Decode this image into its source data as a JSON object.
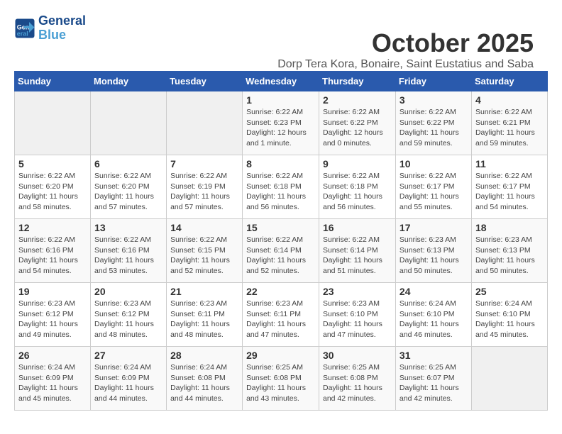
{
  "logo": {
    "line1": "General",
    "line2": "Blue"
  },
  "title": "October 2025",
  "subtitle": "Dorp Tera Kora, Bonaire, Saint Eustatius and Saba",
  "weekdays": [
    "Sunday",
    "Monday",
    "Tuesday",
    "Wednesday",
    "Thursday",
    "Friday",
    "Saturday"
  ],
  "weeks": [
    [
      {
        "day": "",
        "info": ""
      },
      {
        "day": "",
        "info": ""
      },
      {
        "day": "",
        "info": ""
      },
      {
        "day": "1",
        "info": "Sunrise: 6:22 AM\nSunset: 6:23 PM\nDaylight: 12 hours\nand 1 minute."
      },
      {
        "day": "2",
        "info": "Sunrise: 6:22 AM\nSunset: 6:22 PM\nDaylight: 12 hours\nand 0 minutes."
      },
      {
        "day": "3",
        "info": "Sunrise: 6:22 AM\nSunset: 6:22 PM\nDaylight: 11 hours\nand 59 minutes."
      },
      {
        "day": "4",
        "info": "Sunrise: 6:22 AM\nSunset: 6:21 PM\nDaylight: 11 hours\nand 59 minutes."
      }
    ],
    [
      {
        "day": "5",
        "info": "Sunrise: 6:22 AM\nSunset: 6:20 PM\nDaylight: 11 hours\nand 58 minutes."
      },
      {
        "day": "6",
        "info": "Sunrise: 6:22 AM\nSunset: 6:20 PM\nDaylight: 11 hours\nand 57 minutes."
      },
      {
        "day": "7",
        "info": "Sunrise: 6:22 AM\nSunset: 6:19 PM\nDaylight: 11 hours\nand 57 minutes."
      },
      {
        "day": "8",
        "info": "Sunrise: 6:22 AM\nSunset: 6:18 PM\nDaylight: 11 hours\nand 56 minutes."
      },
      {
        "day": "9",
        "info": "Sunrise: 6:22 AM\nSunset: 6:18 PM\nDaylight: 11 hours\nand 56 minutes."
      },
      {
        "day": "10",
        "info": "Sunrise: 6:22 AM\nSunset: 6:17 PM\nDaylight: 11 hours\nand 55 minutes."
      },
      {
        "day": "11",
        "info": "Sunrise: 6:22 AM\nSunset: 6:17 PM\nDaylight: 11 hours\nand 54 minutes."
      }
    ],
    [
      {
        "day": "12",
        "info": "Sunrise: 6:22 AM\nSunset: 6:16 PM\nDaylight: 11 hours\nand 54 minutes."
      },
      {
        "day": "13",
        "info": "Sunrise: 6:22 AM\nSunset: 6:16 PM\nDaylight: 11 hours\nand 53 minutes."
      },
      {
        "day": "14",
        "info": "Sunrise: 6:22 AM\nSunset: 6:15 PM\nDaylight: 11 hours\nand 52 minutes."
      },
      {
        "day": "15",
        "info": "Sunrise: 6:22 AM\nSunset: 6:14 PM\nDaylight: 11 hours\nand 52 minutes."
      },
      {
        "day": "16",
        "info": "Sunrise: 6:22 AM\nSunset: 6:14 PM\nDaylight: 11 hours\nand 51 minutes."
      },
      {
        "day": "17",
        "info": "Sunrise: 6:23 AM\nSunset: 6:13 PM\nDaylight: 11 hours\nand 50 minutes."
      },
      {
        "day": "18",
        "info": "Sunrise: 6:23 AM\nSunset: 6:13 PM\nDaylight: 11 hours\nand 50 minutes."
      }
    ],
    [
      {
        "day": "19",
        "info": "Sunrise: 6:23 AM\nSunset: 6:12 PM\nDaylight: 11 hours\nand 49 minutes."
      },
      {
        "day": "20",
        "info": "Sunrise: 6:23 AM\nSunset: 6:12 PM\nDaylight: 11 hours\nand 48 minutes."
      },
      {
        "day": "21",
        "info": "Sunrise: 6:23 AM\nSunset: 6:11 PM\nDaylight: 11 hours\nand 48 minutes."
      },
      {
        "day": "22",
        "info": "Sunrise: 6:23 AM\nSunset: 6:11 PM\nDaylight: 11 hours\nand 47 minutes."
      },
      {
        "day": "23",
        "info": "Sunrise: 6:23 AM\nSunset: 6:10 PM\nDaylight: 11 hours\nand 47 minutes."
      },
      {
        "day": "24",
        "info": "Sunrise: 6:24 AM\nSunset: 6:10 PM\nDaylight: 11 hours\nand 46 minutes."
      },
      {
        "day": "25",
        "info": "Sunrise: 6:24 AM\nSunset: 6:10 PM\nDaylight: 11 hours\nand 45 minutes."
      }
    ],
    [
      {
        "day": "26",
        "info": "Sunrise: 6:24 AM\nSunset: 6:09 PM\nDaylight: 11 hours\nand 45 minutes."
      },
      {
        "day": "27",
        "info": "Sunrise: 6:24 AM\nSunset: 6:09 PM\nDaylight: 11 hours\nand 44 minutes."
      },
      {
        "day": "28",
        "info": "Sunrise: 6:24 AM\nSunset: 6:08 PM\nDaylight: 11 hours\nand 44 minutes."
      },
      {
        "day": "29",
        "info": "Sunrise: 6:25 AM\nSunset: 6:08 PM\nDaylight: 11 hours\nand 43 minutes."
      },
      {
        "day": "30",
        "info": "Sunrise: 6:25 AM\nSunset: 6:08 PM\nDaylight: 11 hours\nand 42 minutes."
      },
      {
        "day": "31",
        "info": "Sunrise: 6:25 AM\nSunset: 6:07 PM\nDaylight: 11 hours\nand 42 minutes."
      },
      {
        "day": "",
        "info": ""
      }
    ]
  ]
}
